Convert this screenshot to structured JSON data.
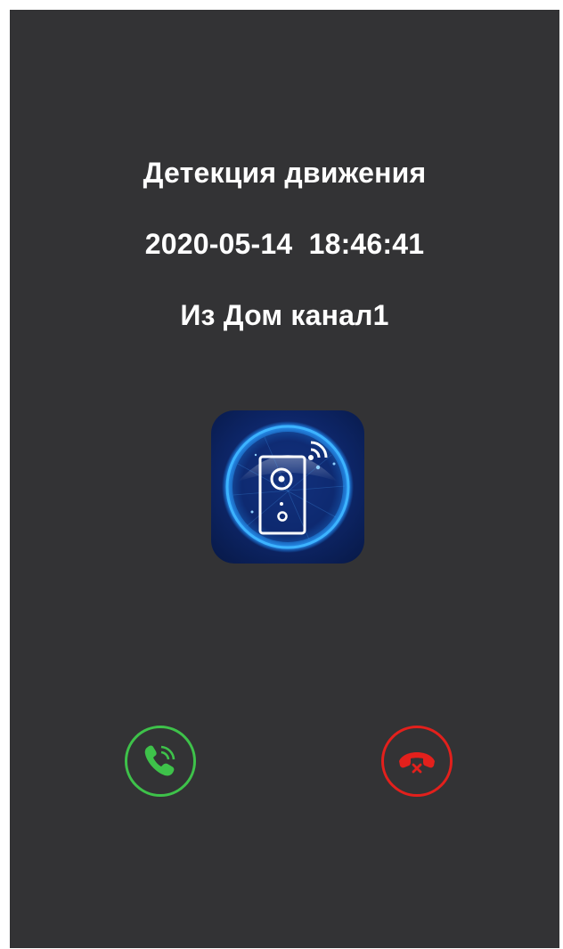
{
  "alert": {
    "title": "Детекция движения",
    "datetime": "2020-05-14  18:46:41",
    "source": "Из Дом канал1"
  },
  "icons": {
    "logo": "doorbell-camera-app-icon",
    "answer": "phone-answer-icon",
    "decline": "phone-hangup-icon"
  },
  "colors": {
    "background": "#333335",
    "text": "#ffffff",
    "answer": "#3ec24a",
    "decline": "#e3201c",
    "logo_bg": "#0b1f55",
    "logo_glow": "#1e8bff"
  }
}
